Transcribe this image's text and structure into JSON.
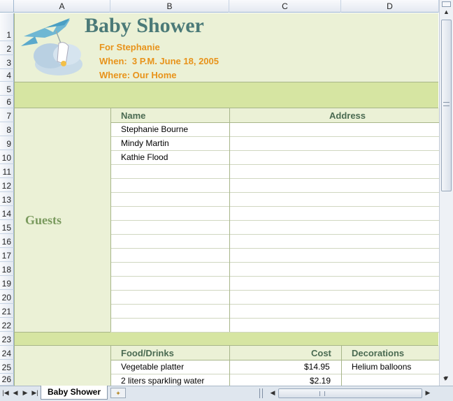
{
  "columns": [
    "A",
    "B",
    "C",
    "D"
  ],
  "rows": [
    "1",
    "2",
    "3",
    "4",
    "5",
    "6",
    "7",
    "8",
    "9",
    "10",
    "11",
    "12",
    "13",
    "14",
    "15",
    "16",
    "17",
    "18",
    "19",
    "20",
    "21",
    "22",
    "23",
    "24",
    "25",
    "26"
  ],
  "header": {
    "title": "Baby Shower",
    "for": "For Stephanie",
    "when": "When:  3 P.M. June 18, 2005",
    "where": "Where: Our Home"
  },
  "guests": {
    "section_label": "Guests",
    "name_header": "Name",
    "address_header": "Address",
    "names": [
      "Stephanie Bourne",
      "Mindy Martin",
      "Kathie Flood"
    ]
  },
  "food": {
    "header": "Food/Drinks",
    "cost_header": "Cost",
    "decorations_header": "Decorations",
    "items": [
      {
        "name": "Vegetable platter",
        "cost": "$14.95",
        "decoration": "Helium balloons"
      },
      {
        "name": "2 liters sparkling water",
        "cost": "$2.19",
        "decoration": ""
      }
    ]
  },
  "sheet_tab": "Baby Shower",
  "colors": {
    "title": "#4b7a78",
    "orange": "#e8931a",
    "band": "#d6e5a2",
    "pale": "#ebf1d6",
    "guests": "#7a9a5e"
  },
  "icons": [
    "stork-icon",
    "insert-sheet-icon"
  ]
}
